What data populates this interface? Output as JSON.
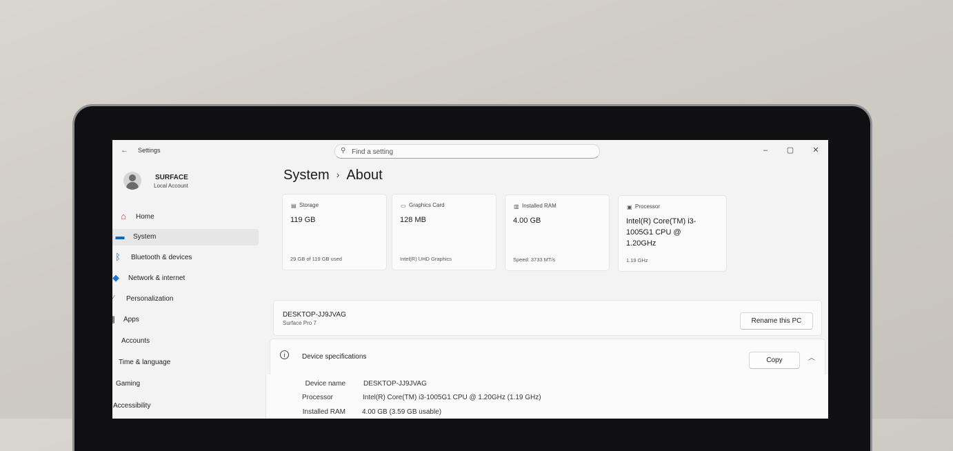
{
  "window": {
    "app_title": "Settings",
    "search_placeholder": "Find a setting",
    "controls": {
      "minimize": "–",
      "maximize": "▢",
      "close": "✕"
    }
  },
  "account": {
    "name": "SURFACE",
    "type": "Local Account"
  },
  "sidebar": {
    "items": [
      {
        "label": "Home",
        "icon": "home-icon",
        "glyph": "⌂",
        "color": "#c0392b"
      },
      {
        "label": "System",
        "icon": "monitor-icon",
        "glyph": "▬",
        "color": "#0067c0",
        "selected": true
      },
      {
        "label": "Bluetooth & devices",
        "icon": "bluetooth-icon",
        "glyph": "ᛒ",
        "color": "#0067c0"
      },
      {
        "label": "Network & internet",
        "icon": "wifi-icon",
        "glyph": "◆",
        "color": "#1a73d9"
      },
      {
        "label": "Personalization",
        "icon": "brush-icon",
        "glyph": "∕",
        "color": "#c8643b"
      },
      {
        "label": "Apps",
        "icon": "apps-icon",
        "glyph": "▦",
        "color": "#3a4a66"
      },
      {
        "label": "Accounts",
        "icon": "person-icon",
        "glyph": "●",
        "color": "#2e9d52"
      },
      {
        "label": "Time & language",
        "icon": "globe-clock-icon",
        "glyph": "◕",
        "color": "#1a73d9"
      },
      {
        "label": "Gaming",
        "icon": "gamepad-icon",
        "glyph": "◒",
        "color": "#6a6a6a"
      },
      {
        "label": "Accessibility",
        "icon": "accessibility-icon",
        "glyph": "⚲",
        "color": "#1a73d9"
      }
    ]
  },
  "header": {
    "parent": "System",
    "separator": "›",
    "current": "About"
  },
  "cards": [
    {
      "label": "Storage",
      "icon": "storage-icon",
      "glyph": "▤",
      "value": "119 GB",
      "sub": "29 GB of 119 GB used"
    },
    {
      "label": "Graphics Card",
      "icon": "graphics-card-icon",
      "glyph": "▭",
      "value": "128 MB",
      "sub": "Intel(R) UHD Graphics"
    },
    {
      "label": "Installed RAM",
      "icon": "ram-icon",
      "glyph": "▥",
      "value": "4.00 GB",
      "sub": "Speed: 3733 MT/s"
    },
    {
      "label": "Processor",
      "icon": "processor-icon",
      "glyph": "▣",
      "value": "Intel(R) Core(TM) i3-1005G1 CPU @ 1.20GHz",
      "sub": "1.19 GHz"
    }
  ],
  "pc": {
    "name": "DESKTOP-JJ9JVAG",
    "model": "Surface Pro 7",
    "rename_label": "Rename this PC"
  },
  "specs": {
    "title": "Device specifications",
    "copy_label": "Copy",
    "rows": [
      {
        "key": "Device name",
        "value": "DESKTOP-JJ9JVAG"
      },
      {
        "key": "Processor",
        "value": "Intel(R) Core(TM) i3-1005G1 CPU @ 1.20GHz (1.19 GHz)"
      },
      {
        "key": "Installed RAM",
        "value": "4.00 GB (3.59 GB usable)"
      }
    ]
  }
}
